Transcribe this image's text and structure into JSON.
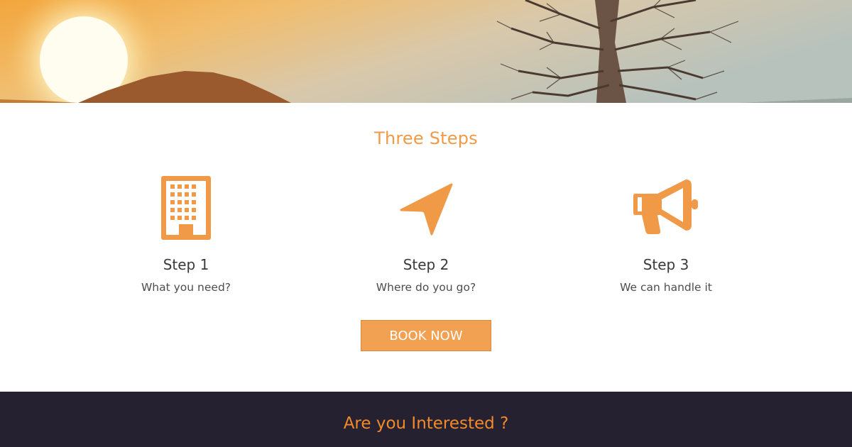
{
  "hero": {
    "image": "sunset-landscape-with-tree"
  },
  "steps_section": {
    "title": "Three Steps",
    "accent_color": "#f09a48",
    "steps": [
      {
        "icon": "building-icon",
        "title": "Step 1",
        "subtitle": "What you need?"
      },
      {
        "icon": "navigation-arrow-icon",
        "title": "Step 2",
        "subtitle": "Where do you go?"
      },
      {
        "icon": "megaphone-icon",
        "title": "Step 3",
        "subtitle": "We can handle it"
      }
    ],
    "book_button": {
      "label": "BOOK NOW",
      "color": "#f2a052"
    }
  },
  "interest_section": {
    "title": "Are you Interested ?",
    "background": "#252131",
    "title_color": "#f28a2a"
  }
}
